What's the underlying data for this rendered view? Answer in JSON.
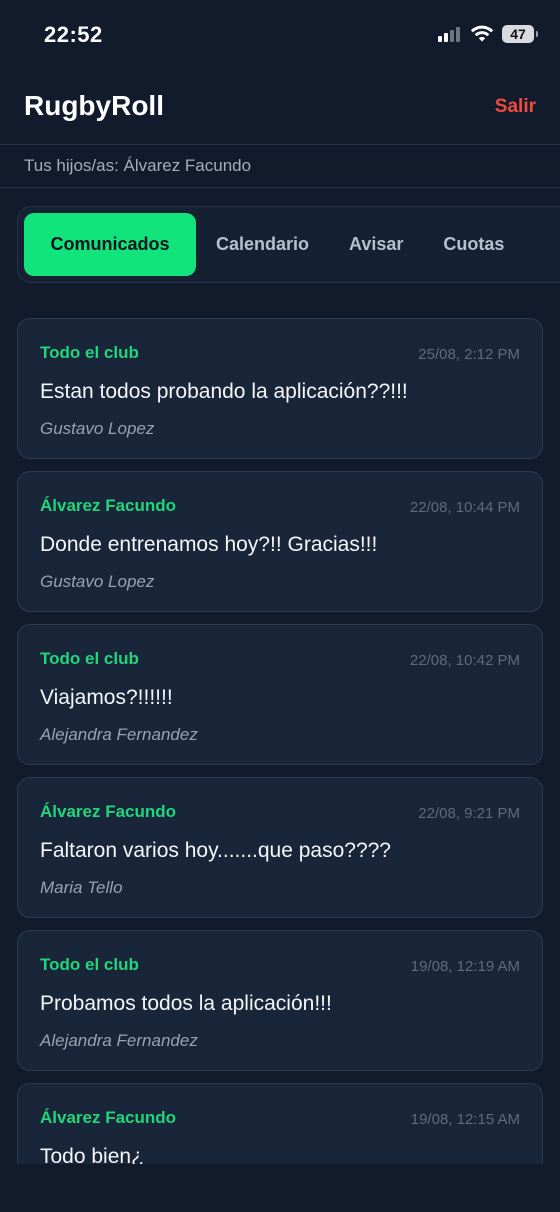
{
  "status_bar": {
    "time": "22:52",
    "battery": "47"
  },
  "header": {
    "title": "RugbyRoll",
    "logout_label": "Salir"
  },
  "subheader": {
    "children_label": "Tus hijos/as: Álvarez Facundo"
  },
  "tabs": [
    {
      "label": "Comunicados",
      "active": true
    },
    {
      "label": "Calendario",
      "active": false
    },
    {
      "label": "Avisar",
      "active": false
    },
    {
      "label": "Cuotas",
      "active": false
    }
  ],
  "messages": [
    {
      "recipient": "Todo el club",
      "date": "25/08, 2:12 PM",
      "text": "Estan todos probando la aplicación??!!!",
      "author": "Gustavo Lopez"
    },
    {
      "recipient": "Álvarez Facundo",
      "date": "22/08, 10:44 PM",
      "text": "Donde entrenamos hoy?!! Gracias!!!",
      "author": "Gustavo Lopez"
    },
    {
      "recipient": "Todo el club",
      "date": "22/08, 10:42 PM",
      "text": "Viajamos?!!!!!!",
      "author": "Alejandra Fernandez"
    },
    {
      "recipient": "Álvarez Facundo",
      "date": "22/08, 9:21 PM",
      "text": "Faltaron varios hoy.......que paso????",
      "author": "Maria Tello"
    },
    {
      "recipient": "Todo el club",
      "date": "19/08, 12:19 AM",
      "text": "Probamos todos la aplicación!!!",
      "author": "Alejandra Fernandez"
    },
    {
      "recipient": "Álvarez Facundo",
      "date": "19/08, 12:15 AM",
      "text": "Todo bien¿",
      "author": ""
    }
  ],
  "colors": {
    "background": "#121b2b",
    "accent_green": "#11e47a",
    "logout_red": "#f04b3f"
  }
}
